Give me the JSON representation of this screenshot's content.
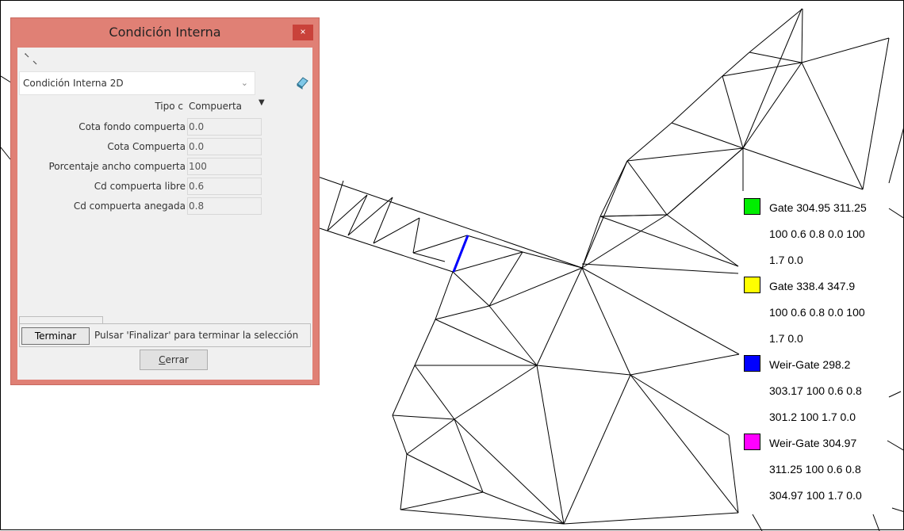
{
  "dialog": {
    "title": "Condición Interna",
    "close_glyph": "×",
    "combo_value": "Condición Interna 2D",
    "type_label": "Tipo c",
    "type_value": "Compuerta",
    "fields": [
      {
        "label": "Cota fondo compuerta",
        "value": "0.0"
      },
      {
        "label": "Cota Compuerta",
        "value": "0.0"
      },
      {
        "label": "Porcentaje ancho compuerta",
        "value": "100"
      },
      {
        "label": "Cd compuerta libre",
        "value": "0.6"
      },
      {
        "label": "Cd compuerta anegada",
        "value": "0.8"
      }
    ],
    "finish_label": "Terminar",
    "status_text": "Pulsar 'Finalizar' para terminar la selección",
    "close_label": "Cerrar",
    "close_label_rest": "errar",
    "close_label_access": "C"
  },
  "legend": [
    {
      "color": "#00ee00",
      "lines": [
        "Gate 304.95 311.25",
        "100 0.6 0.8 0.0 100",
        "1.7 0.0"
      ]
    },
    {
      "color": "#ffff00",
      "lines": [
        "Gate 338.4 347.9",
        "100 0.6 0.8 0.0 100",
        "1.7 0.0"
      ]
    },
    {
      "color": "#0000ff",
      "lines": [
        "Weir-Gate 298.2",
        "303.17 100 0.6 0.8",
        "301.2 100 1.7 0.0"
      ]
    },
    {
      "color": "#ff00ff",
      "lines": [
        "Weir-Gate 304.97",
        "311.25 100 0.6 0.8",
        "304.97 100 1.7 0.0"
      ]
    }
  ],
  "colors": {
    "highlight_edge": "#0000ff",
    "dialog_frame": "#e08075",
    "mesh": "#000000"
  },
  "icons": {
    "toolbar": "select-arrow-icon",
    "side": "eraser-icon",
    "combo": "chevron-down-icon",
    "type": "dropdown-triangle-icon"
  }
}
